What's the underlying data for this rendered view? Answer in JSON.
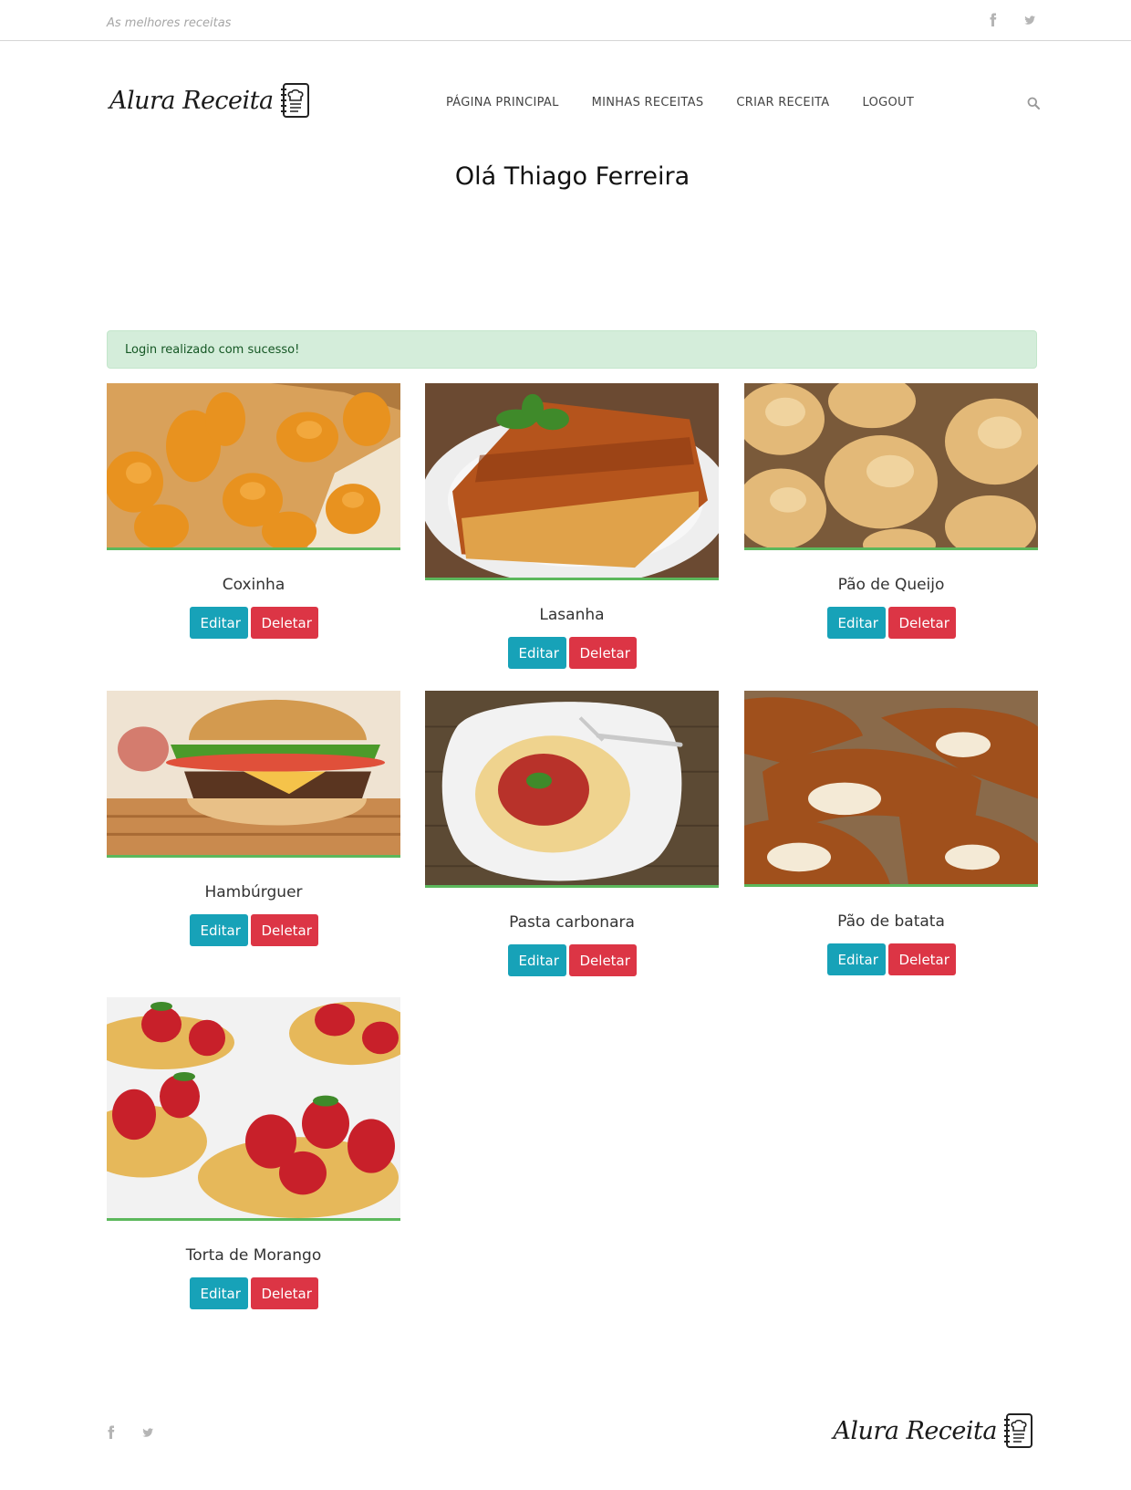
{
  "topbar": {
    "tagline": "As melhores receitas",
    "social_icons": [
      "facebook-icon",
      "twitter-icon"
    ]
  },
  "header": {
    "logo_text": "Alura Receita",
    "logo_icon": "recipe-book-icon",
    "nav": [
      "PÁGINA PRINCIPAL",
      "MINHAS RECEITAS",
      "CRIAR RECEITA",
      "LOGOUT"
    ],
    "search_icon": "search-icon"
  },
  "page": {
    "title": "Olá Thiago Ferreira"
  },
  "alert": {
    "message": "Login realizado com sucesso!",
    "color": "#d4edda"
  },
  "recipes": [
    {
      "name": "Coxinha",
      "image": "fried coxinha snacks in a basket"
    },
    {
      "name": "Lasanha",
      "image": "lasagna slice with basil on a plate"
    },
    {
      "name": "Pão de Queijo",
      "image": "cheese bread rolls"
    },
    {
      "name": "Hambúrguer",
      "image": "cheeseburger with lettuce and tomato"
    },
    {
      "name": "Pasta carbonara",
      "image": "spaghetti with tomato sauce on a plate"
    },
    {
      "name": "Pão de batata",
      "image": "pretzel breads with salt"
    },
    {
      "name": "Torta de Morango",
      "image": "strawberry tarts"
    }
  ],
  "buttons": {
    "edit_label": "Editar",
    "delete_label": "Deletar",
    "edit_color": "#17a2b8",
    "delete_color": "#dc3545"
  },
  "footer": {
    "logo_text": "Alura Receita",
    "social_icons": [
      "facebook-icon",
      "twitter-icon"
    ]
  },
  "colors": {
    "image_border": "#5cb85c"
  }
}
